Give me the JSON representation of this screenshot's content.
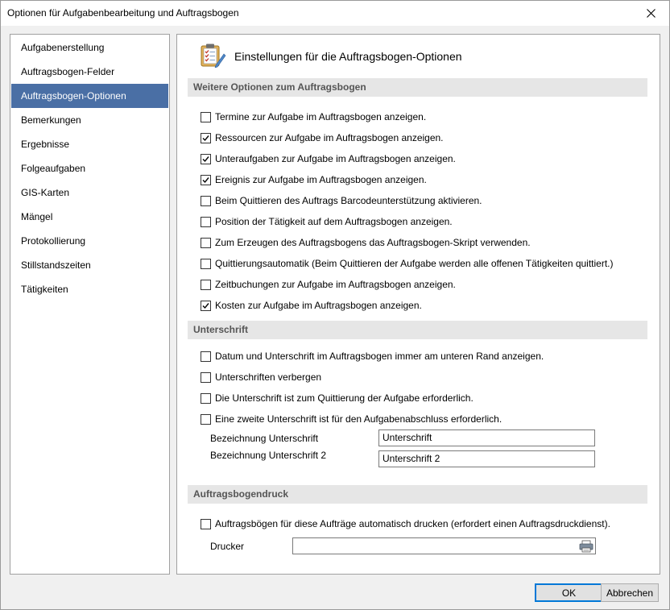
{
  "window": {
    "title": "Optionen für Aufgabenbearbeitung und Auftragsbogen"
  },
  "nav": {
    "items": [
      "Aufgabenerstellung",
      "Auftragsbogen-Felder",
      "Auftragsbogen-Optionen",
      "Bemerkungen",
      "Ergebnisse",
      "Folgeaufgaben",
      "GIS-Karten",
      "Mängel",
      "Protokollierung",
      "Stillstandszeiten",
      "Tätigkeiten"
    ],
    "selected": "Auftragsbogen-Optionen"
  },
  "header": {
    "title": "Einstellungen für die Auftragsbogen-Optionen",
    "icon": "clipboard-checklist-icon"
  },
  "sections": {
    "weitere": {
      "title": "Weitere Optionen zum Auftragsbogen",
      "options": [
        {
          "label": "Termine zur Aufgabe im Auftragsbogen anzeigen.",
          "checked": false
        },
        {
          "label": "Ressourcen zur Aufgabe im Auftragsbogen anzeigen.",
          "checked": true
        },
        {
          "label": "Unteraufgaben zur Aufgabe im Auftragsbogen anzeigen.",
          "checked": true
        },
        {
          "label": "Ereignis zur Aufgabe im Auftragsbogen anzeigen.",
          "checked": true
        },
        {
          "label": "Beim Quittieren des Auftrags Barcodeunterstützung aktivieren.",
          "checked": false
        },
        {
          "label": "Position der Tätigkeit auf dem Auftragsbogen anzeigen.",
          "checked": false
        },
        {
          "label": "Zum Erzeugen des Auftragsbogens das Auftragsbogen-Skript verwenden.",
          "checked": false
        },
        {
          "label": "Quittierungsautomatik (Beim Quittieren der Aufgabe werden alle offenen Tätigkeiten quittiert.)",
          "checked": false
        },
        {
          "label": "Zeitbuchungen zur Aufgabe im Auftragsbogen anzeigen.",
          "checked": false
        },
        {
          "label": "Kosten zur Aufgabe im Auftragsbogen anzeigen.",
          "checked": true
        }
      ]
    },
    "unterschrift": {
      "title": "Unterschrift",
      "options": [
        {
          "label": "Datum und Unterschrift im Auftragsbogen immer am unteren Rand anzeigen.",
          "checked": false
        },
        {
          "label": "Unterschriften verbergen",
          "checked": false
        },
        {
          "label": "Die Unterschrift ist zum Quittierung der Aufgabe erforderlich.",
          "checked": false
        },
        {
          "label": "Eine zweite Unterschrift ist für den Aufgabenabschluss erforderlich.",
          "checked": false
        }
      ],
      "field1_label": "Bezeichnung Unterschrift",
      "field1_value": "Unterschrift",
      "field2_label": "Bezeichnung Unterschrift 2",
      "field2_value": "Unterschrift 2"
    },
    "druck": {
      "title": "Auftragsbogendruck",
      "options": [
        {
          "label": "Auftragsbögen für diese Aufträge automatisch drucken (erfordert einen Auftragsdruckdienst).",
          "checked": false
        }
      ],
      "printer_label": "Drucker",
      "printer_value": ""
    }
  },
  "buttons": {
    "ok": "OK",
    "cancel": "Abbrechen"
  },
  "colors": {
    "selection": "#4a6fa5",
    "default_button_border": "#0078d7",
    "section_bg": "#e6e6e6"
  }
}
